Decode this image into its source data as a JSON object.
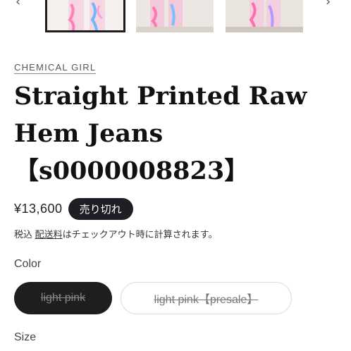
{
  "gallery": {
    "prev_icon": "chevron-left-icon",
    "next_icon": "chevron-right-icon",
    "prev_glyph": "‹",
    "next_glyph": "›",
    "thumb_colors": [
      "#ff9ecb",
      "#7fc7ff",
      "#b8a2ff"
    ]
  },
  "product": {
    "vendor": "CHEMICAL GIRL",
    "title": "Straight Printed Raw Hem Jeans 【s0000008823】",
    "price": "¥13,600",
    "badge": "売り切れ",
    "tax_prefix": "税込 ",
    "tax_link": "配送料",
    "tax_suffix": "はチェックアウト時に計算されます。"
  },
  "options": {
    "color_label": "Color",
    "colors": [
      "light pink",
      "light pink【presale】"
    ],
    "size_label": "Size"
  }
}
